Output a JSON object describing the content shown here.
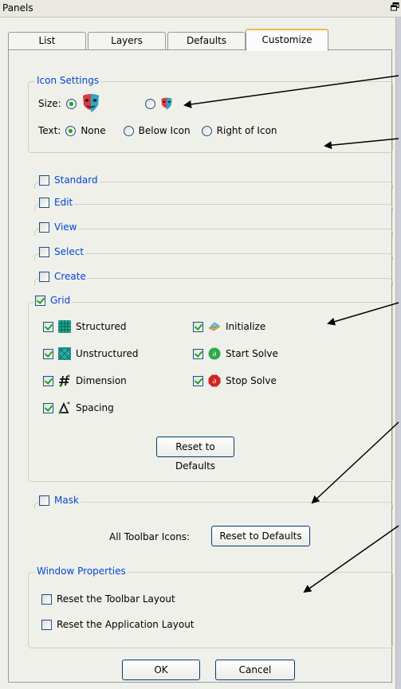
{
  "window": {
    "title": "Panels"
  },
  "tabs": [
    "List",
    "Layers",
    "Defaults",
    "Customize"
  ],
  "icon_settings": {
    "legend": "Icon Settings",
    "size_label": "Size:",
    "text_label": "Text:",
    "text_options": [
      "None",
      "Below Icon",
      "Right of Icon"
    ]
  },
  "toolbars": {
    "standard": "Standard",
    "edit": "Edit",
    "view": "View",
    "select": "Select",
    "create": "Create",
    "grid": "Grid",
    "mask": "Mask"
  },
  "grid_items": {
    "structured": "Structured",
    "unstructured": "Unstructured",
    "dimension": "Dimension",
    "spacing": "Spacing",
    "initialize": "Initialize",
    "start_solve": "Start Solve",
    "stop_solve": "Stop Solve",
    "reset": "Reset to Defaults"
  },
  "all_toolbar": {
    "label": "All Toolbar Icons:",
    "reset": "Reset to Defaults"
  },
  "window_properties": {
    "legend": "Window Properties",
    "reset_toolbar": "Reset the Toolbar Layout",
    "reset_app": "Reset the Application Layout"
  },
  "buttons": {
    "ok": "OK",
    "cancel": "Cancel"
  },
  "colors": {
    "accent": "#0046d5",
    "check": "#21a121",
    "tab_highlight": "#f4b93f"
  }
}
